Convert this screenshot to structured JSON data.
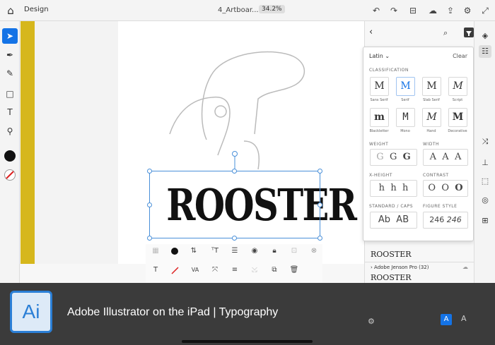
{
  "topbar": {
    "doc_tab": "Design",
    "title": "4_Artboar...",
    "zoom": "34.2%"
  },
  "canvas": {
    "text": "ROOSTER"
  },
  "context_bar": {
    "va_label": "VA"
  },
  "font_panel": {
    "script_selector": "Latin",
    "clear": "Clear",
    "sections": {
      "classification": "CLASSIFICATION",
      "weight": "WEIGHT",
      "width": "WIDTH",
      "xheight": "X-HEIGHT",
      "contrast": "CONTRAST",
      "standard": "STANDARD / CAPS",
      "figure": "FIGURE STYLE"
    },
    "classifications": [
      {
        "glyph": "M",
        "label": "Sans Serif"
      },
      {
        "glyph": "M",
        "label": "Serif"
      },
      {
        "glyph": "M",
        "label": "Slab Serif"
      },
      {
        "glyph": "M",
        "label": "Script"
      },
      {
        "glyph": "m",
        "label": "Blackletter"
      },
      {
        "glyph": "M",
        "label": "Mono"
      },
      {
        "glyph": "M",
        "label": "Hand"
      },
      {
        "glyph": "M",
        "label": "Decorative"
      }
    ],
    "weight": [
      "G",
      "G",
      "G"
    ],
    "width": [
      "A",
      "A",
      "A"
    ],
    "xheight": [
      "h",
      "h",
      "h"
    ],
    "contrast": [
      "O",
      "O",
      "O"
    ],
    "standard": [
      "Ab",
      "AB"
    ],
    "figure": [
      "246",
      "246"
    ]
  },
  "font_list": {
    "sample1": "ROOSTER",
    "font2": "Adobe Jenson Pro (32)",
    "sample2": "ROOSTER"
  },
  "right_bottom": {
    "a1": "A",
    "a2": "A"
  },
  "footer": {
    "logo": "Ai",
    "title": "Adobe Illustrator on the iPad  |  Typography"
  }
}
